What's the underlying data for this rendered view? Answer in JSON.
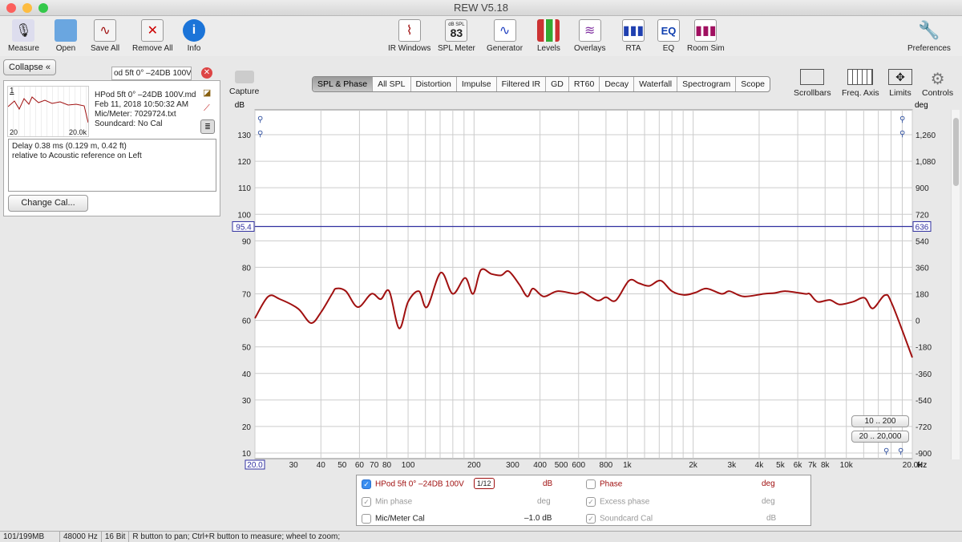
{
  "window": {
    "title": "REW V5.18"
  },
  "toolbar": {
    "left": [
      {
        "label": "Measure",
        "icon": "microphone-icon"
      },
      {
        "label": "Open",
        "icon": "folder-icon"
      },
      {
        "label": "Save All",
        "icon": "save-all-icon"
      },
      {
        "label": "Remove All",
        "icon": "remove-all-icon"
      },
      {
        "label": "Info",
        "icon": "info-icon"
      }
    ],
    "center": [
      {
        "label": "IR Windows",
        "icon": "ir-windows-icon"
      },
      {
        "label": "SPL Meter",
        "icon": "spl-meter-icon",
        "badge_top": "dB SPL",
        "badge_value": "83"
      },
      {
        "label": "Generator",
        "icon": "generator-icon"
      },
      {
        "label": "Levels",
        "icon": "levels-icon"
      },
      {
        "label": "Overlays",
        "icon": "overlays-icon"
      },
      {
        "label": "RTA",
        "icon": "rta-icon"
      },
      {
        "label": "EQ",
        "icon": "eq-icon"
      },
      {
        "label": "Room Sim",
        "icon": "room-sim-icon"
      }
    ],
    "preferences": "Preferences"
  },
  "measurement_panel": {
    "collapse_label": "Collapse",
    "name_field": "od 5ft 0° –24DB 100V",
    "file": "HPod 5ft 0° –24DB 100V.md",
    "date": "Feb 11, 2018 10:50:32 AM",
    "mic": "Mic/Meter: 7029724.txt",
    "soundcard": "Soundcard: No Cal",
    "thumb_index": "1",
    "thumb_xmin": "20",
    "thumb_xmax": "20.0k",
    "notes_line1": "Delay 0.38 ms (0.129 m, 0.42 ft)",
    "notes_line2": "relative to Acoustic reference on  Left",
    "change_cal": "Change Cal..."
  },
  "capture_label": "Capture",
  "tabs": [
    {
      "label": "SPL & Phase",
      "active": true
    },
    {
      "label": "All SPL"
    },
    {
      "label": "Distortion"
    },
    {
      "label": "Impulse"
    },
    {
      "label": "Filtered IR"
    },
    {
      "label": "GD"
    },
    {
      "label": "RT60"
    },
    {
      "label": "Decay"
    },
    {
      "label": "Waterfall"
    },
    {
      "label": "Spectrogram"
    },
    {
      "label": "Scope"
    }
  ],
  "right_tools": [
    {
      "label": "Scrollbars",
      "icon": "scrollbars-icon"
    },
    {
      "label": "Freq. Axis",
      "icon": "freq-axis-icon"
    },
    {
      "label": "Limits",
      "icon": "limits-icon"
    },
    {
      "label": "Controls",
      "icon": "gear-icon"
    }
  ],
  "range_buttons": [
    "10 .. 200",
    "20 .. 20,000"
  ],
  "legend": {
    "trace": "HPod 5ft 0° –24DB 100V",
    "smoothing_num": "1",
    "smoothing_den": "12",
    "trace_unit": "dB",
    "phase": "Phase",
    "phase_unit": "deg",
    "min_phase": "Min phase",
    "min_phase_unit": "deg",
    "excess_phase": "Excess phase",
    "excess_phase_unit": "deg",
    "mic_cal": "Mic/Meter Cal",
    "mic_cal_value": "–1.0 dB",
    "soundcard_cal": "Soundcard Cal",
    "soundcard_cal_unit": "dB"
  },
  "status": {
    "memory": "101/199MB",
    "rate": "48000 Hz",
    "bits": "16 Bit",
    "hint": "R button to pan; Ctrl+R button to measure; wheel to zoom;"
  },
  "colors": {
    "trace": "#a01010",
    "marker": "#3030a0"
  },
  "chart_data": {
    "type": "line",
    "ylabel": "dB",
    "y2label": "deg",
    "xunit": "Hz",
    "xscale": "log",
    "xlim": [
      20,
      20000
    ],
    "ylim": [
      10,
      130
    ],
    "y2lim": [
      -900,
      1260
    ],
    "grid": true,
    "x_tick_labels": [
      "20.0",
      "30",
      "40",
      "50",
      "60",
      "70",
      "80",
      "100",
      "200",
      "300",
      "400",
      "500",
      "600",
      "800",
      "1k",
      "2k",
      "3k",
      "4k",
      "5k",
      "6k",
      "7k",
      "8k",
      "10k",
      "20.0k"
    ],
    "x_tick_values": [
      20,
      30,
      40,
      50,
      60,
      70,
      80,
      100,
      200,
      300,
      400,
      500,
      600,
      800,
      1000,
      2000,
      3000,
      4000,
      5000,
      6000,
      7000,
      8000,
      10000,
      20000
    ],
    "y_ticks": [
      "10",
      "20",
      "30",
      "40",
      "50",
      "60",
      "70",
      "80",
      "90",
      "100",
      "110",
      "120",
      "130"
    ],
    "y2_ticks": [
      "-900",
      "-720",
      "-540",
      "-360",
      "-180",
      "0",
      "180",
      "360",
      "540",
      "720",
      "900",
      "1,080",
      "1,260"
    ],
    "cursor": {
      "y": "95.4",
      "y2": "636"
    },
    "series": [
      {
        "x": [
          20,
          23,
          26,
          31.5,
          36,
          40,
          45,
          47,
          52,
          59,
          68,
          75,
          82,
          91,
          100,
          112,
          122,
          141,
          160,
          182,
          198,
          215,
          240,
          266,
          288,
          322,
          350,
          372,
          416,
          480,
          582,
          628,
          730,
          800,
          886,
          1020,
          1130,
          1260,
          1420,
          1600,
          1820,
          2050,
          2300,
          2700,
          2930,
          3400,
          4200,
          4700,
          5300,
          6500,
          6800,
          7400,
          8400,
          9300,
          10700,
          12100,
          13200,
          15000,
          16200,
          20000
        ],
        "y": [
          60.8,
          69,
          68,
          64.4,
          59,
          63,
          70,
          72,
          71,
          65,
          70,
          68,
          71,
          57,
          67,
          71,
          65,
          78,
          70,
          76,
          70,
          79,
          77.5,
          77,
          78.5,
          73.5,
          69,
          72,
          69,
          71,
          70,
          70.6,
          67.5,
          68.7,
          67.5,
          75,
          74,
          73,
          75,
          71,
          69.6,
          70.5,
          72,
          70,
          71,
          69,
          70,
          70.3,
          71,
          70,
          70,
          67,
          67.7,
          66,
          67,
          68.5,
          64.5,
          69.5,
          66,
          46
        ]
      }
    ]
  }
}
